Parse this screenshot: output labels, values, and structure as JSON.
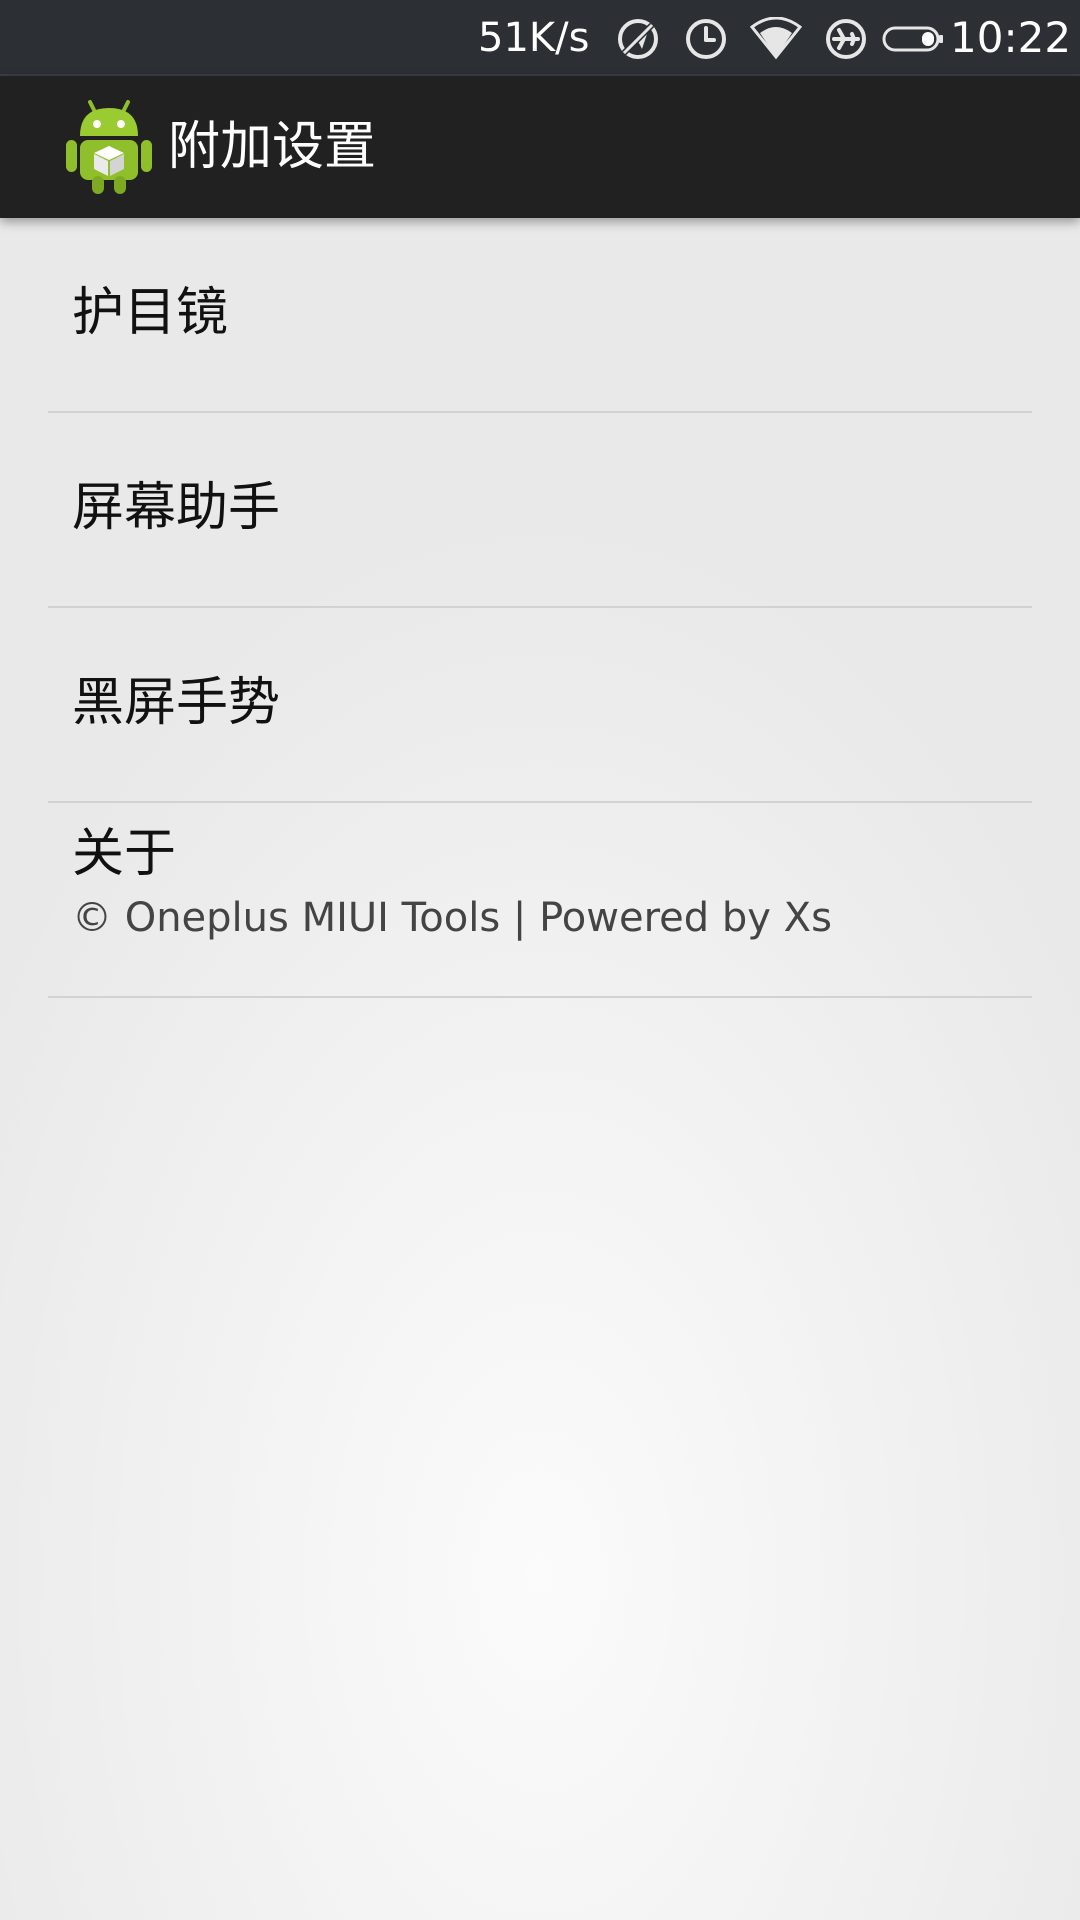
{
  "status_bar": {
    "net_speed": "51K/s",
    "icons": [
      "location-off-icon",
      "alarm-icon",
      "wifi-icon",
      "airplane-mode-icon",
      "battery-icon"
    ],
    "time": "10:22"
  },
  "action_bar": {
    "app_icon": "android-robot-icon",
    "title": "附加设置"
  },
  "preferences": [
    {
      "title": "护目镜"
    },
    {
      "title": "屏幕助手"
    },
    {
      "title": "黑屏手势"
    },
    {
      "title": "关于",
      "summary": "© Oneplus MIUI Tools | Powered by Xs"
    }
  ],
  "colors": {
    "status_bar_bg": "#2c2f33",
    "action_bar_bg": "#212121",
    "list_bg": "#ececec",
    "divider": "#d2d2d2",
    "android_green": "#8fbf2a"
  }
}
